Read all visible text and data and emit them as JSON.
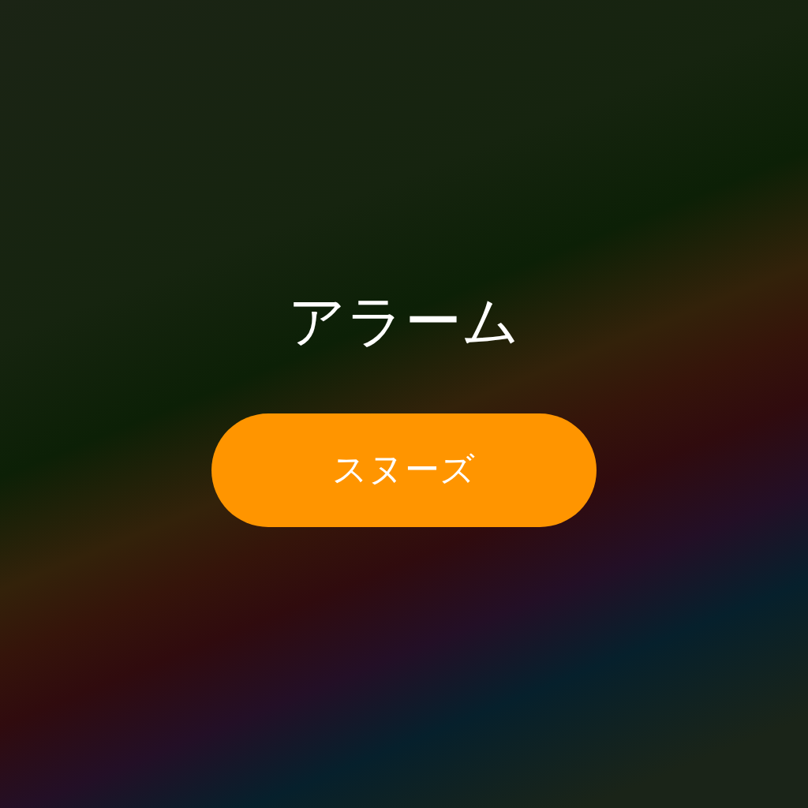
{
  "alarm": {
    "title": "アラーム"
  },
  "snooze_button": {
    "label": "スヌーズ"
  }
}
